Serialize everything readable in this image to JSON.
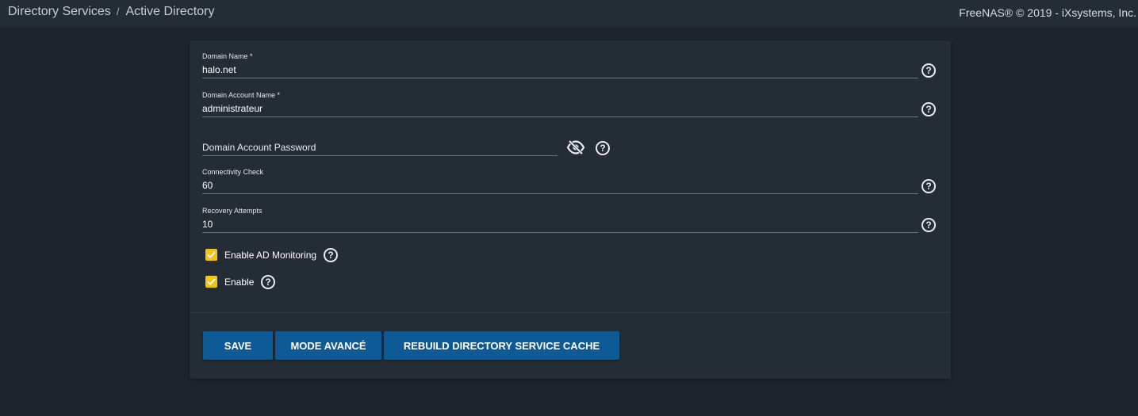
{
  "header": {
    "breadcrumb": [
      "Directory Services",
      "Active Directory"
    ],
    "breadcrumb_separator": "/",
    "copyright": "FreeNAS® © 2019 - iXsystems, Inc."
  },
  "form": {
    "domain_name": {
      "label": "Domain Name *",
      "value": "halo.net",
      "help_icon": "help-circle-icon"
    },
    "domain_account_name": {
      "label": "Domain Account Name *",
      "value": "administrateur",
      "help_icon": "help-circle-icon"
    },
    "domain_account_password": {
      "placeholder": "Domain Account Password",
      "value": "",
      "toggle_icon": "eye-off-icon",
      "help_icon": "help-circle-icon"
    },
    "connectivity_check": {
      "label": "Connectivity Check",
      "value": "60",
      "help_icon": "help-circle-icon"
    },
    "recovery_attempts": {
      "label": "Recovery Attempts",
      "value": "10",
      "help_icon": "help-circle-icon"
    },
    "enable_ad_monitoring": {
      "label": "Enable AD Monitoring",
      "checked": true
    },
    "enable": {
      "label": "Enable",
      "checked": true
    }
  },
  "buttons": {
    "save": "SAVE",
    "advanced_mode": "MODE AVANCÉ",
    "rebuild_cache": "REBUILD DIRECTORY SERVICE CACHE"
  },
  "colors": {
    "page_background": "#1d242d",
    "card_background": "#242c35",
    "button_primary": "#0d5a96",
    "checkbox_checked": "#f0c419"
  }
}
